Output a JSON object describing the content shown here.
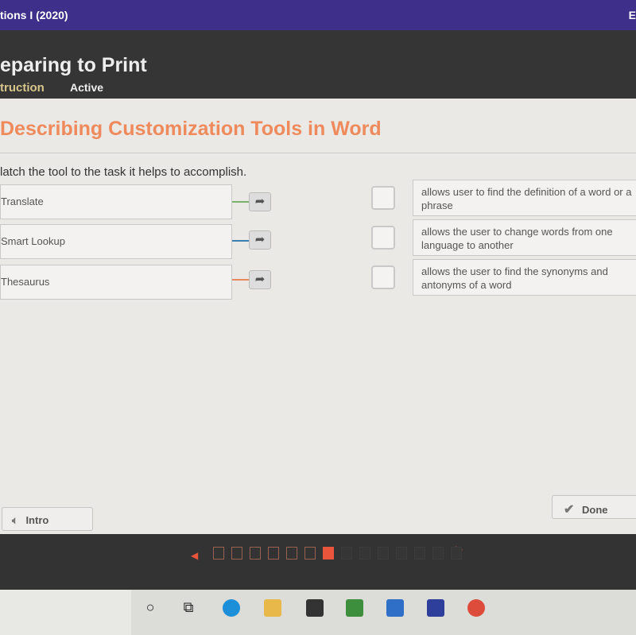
{
  "topbar": {
    "course": "tions I (2020)",
    "right": "E"
  },
  "header": {
    "title": "eparing to Print",
    "tabs": [
      "truction",
      "Active"
    ]
  },
  "activity": {
    "heading": "Describing Customization Tools in Word",
    "instruction": "latch the tool to the task it helps to accomplish.",
    "terms": [
      {
        "label": "Translate",
        "color": "#7cb36a"
      },
      {
        "label": "Smart Lookup",
        "color": "#3b7fb0"
      },
      {
        "label": "Thesaurus",
        "color": "#e8885c"
      }
    ],
    "definitions": [
      "allows user to find the definition of a word or a phrase",
      "allows the user to change words from one language to another",
      "allows the user to find the synonyms and antonyms of a word"
    ]
  },
  "buttons": {
    "intro": "Intro",
    "done": "Done"
  },
  "progress": {
    "current": 7,
    "total": 14,
    "accent": "#e8553a"
  },
  "taskbar": {
    "icons": [
      "search-icon",
      "task-view-icon",
      "edge-icon",
      "file-explorer-icon",
      "store-icon",
      "duolingo-icon",
      "mail-icon",
      "news-icon",
      "chrome-icon"
    ]
  }
}
